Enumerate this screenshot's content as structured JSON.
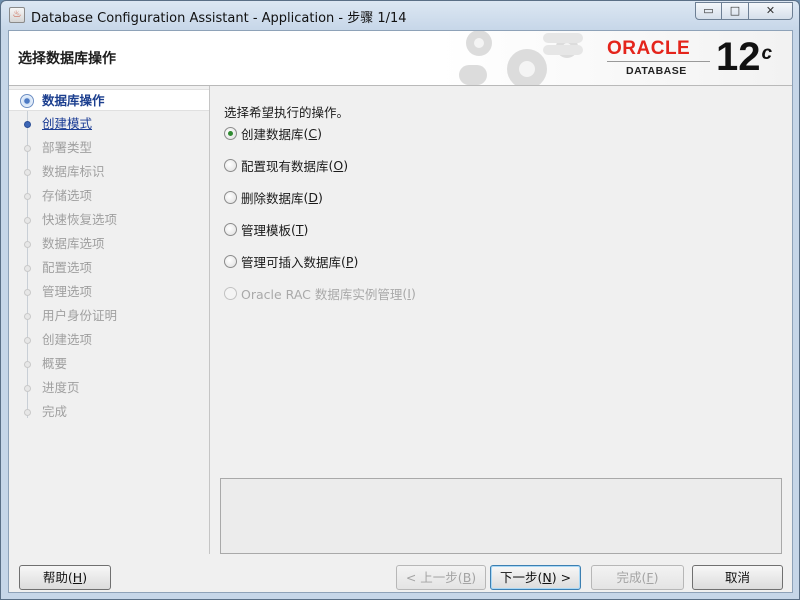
{
  "window": {
    "title": "Database Configuration Assistant - Application - 步骤 1/14",
    "min_glyph": "▭",
    "max_glyph": "□",
    "close_glyph": "✕"
  },
  "header": {
    "page_title": "选择数据库操作",
    "logo_brand": "ORACLE",
    "logo_product": "DATABASE",
    "logo_version": "12",
    "logo_version_suffix": "c",
    "brand_color": "#e4241b"
  },
  "nav": {
    "items": [
      {
        "label": "数据库操作",
        "state": "active"
      },
      {
        "label": "创建模式",
        "state": "link"
      },
      {
        "label": "部署类型",
        "state": "disabled"
      },
      {
        "label": "数据库标识",
        "state": "disabled"
      },
      {
        "label": "存储选项",
        "state": "disabled"
      },
      {
        "label": "快速恢复选项",
        "state": "disabled"
      },
      {
        "label": "数据库选项",
        "state": "disabled"
      },
      {
        "label": "配置选项",
        "state": "disabled"
      },
      {
        "label": "管理选项",
        "state": "disabled"
      },
      {
        "label": "用户身份证明",
        "state": "disabled"
      },
      {
        "label": "创建选项",
        "state": "disabled"
      },
      {
        "label": "概要",
        "state": "disabled"
      },
      {
        "label": "进度页",
        "state": "disabled"
      },
      {
        "label": "完成",
        "state": "disabled"
      }
    ]
  },
  "main": {
    "instruction": "选择希望执行的操作。",
    "options": [
      {
        "label": "创建数据库",
        "mnemonic": "C",
        "checked": true,
        "enabled": true
      },
      {
        "label": "配置现有数据库",
        "mnemonic": "O",
        "checked": false,
        "enabled": true
      },
      {
        "label": "删除数据库",
        "mnemonic": "D",
        "checked": false,
        "enabled": true
      },
      {
        "label": "管理模板",
        "mnemonic": "T",
        "checked": false,
        "enabled": true
      },
      {
        "label": "管理可插入数据库",
        "mnemonic": "P",
        "checked": false,
        "enabled": true
      },
      {
        "label": "Oracle RAC 数据库实例管理",
        "mnemonic": "I",
        "checked": false,
        "enabled": false
      }
    ]
  },
  "footer": {
    "help": {
      "label": "帮助",
      "mnemonic": "H"
    },
    "back": {
      "prefix": "< 上一步",
      "mnemonic": "B"
    },
    "next": {
      "prefix": "下一步",
      "mnemonic": "N",
      "suffix": " >"
    },
    "finish": {
      "label": "完成",
      "mnemonic": "F"
    },
    "cancel": {
      "label": "取消"
    }
  }
}
